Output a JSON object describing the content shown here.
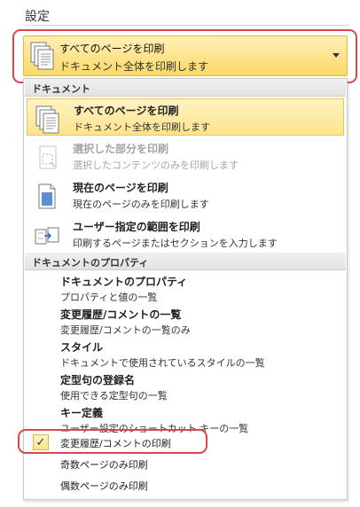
{
  "settings": {
    "title": "設定"
  },
  "dropdown": {
    "title": "すべてのページを印刷",
    "subtitle": "ドキュメント全体を印刷します"
  },
  "menu": {
    "groups": [
      {
        "header": "ドキュメント"
      },
      {
        "header": "ドキュメントのプロパティ"
      }
    ],
    "print_items": [
      {
        "title": "すべてのページを印刷",
        "desc": "ドキュメント全体を印刷します",
        "state": "selected",
        "icon": "all-pages-icon"
      },
      {
        "title": "選択した部分を印刷",
        "desc": "選択したコンテンツのみを印刷します",
        "state": "disabled",
        "icon": "selection-icon"
      },
      {
        "title": "現在のページを印刷",
        "desc": "現在のページのみを印刷します",
        "state": "normal",
        "icon": "current-page-icon"
      },
      {
        "title": "ユーザー指定の範囲を印刷",
        "desc": "印刷するページまたはセクションを入力します",
        "state": "normal",
        "icon": "custom-range-icon"
      }
    ],
    "property_items": [
      {
        "title": "ドキュメントのプロパティ",
        "desc": "プロパティと値の一覧"
      },
      {
        "title": "変更履歴/コメントの一覧",
        "desc": "変更履歴/コメントの一覧のみ"
      },
      {
        "title": "スタイル",
        "desc": "ドキュメントで使用されているスタイルの一覧"
      },
      {
        "title": "定型句の登録名",
        "desc": "使用できる定型句の一覧"
      },
      {
        "title": "キー定義",
        "desc": "ユーザー設定のショートカット キーの一覧"
      }
    ],
    "toggles": [
      {
        "label": "変更履歴/コメントの印刷",
        "checked": true,
        "check_glyph": "✓"
      },
      {
        "label": "奇数ページのみ印刷",
        "checked": false
      },
      {
        "label": "偶数ページのみ印刷",
        "checked": false
      }
    ]
  },
  "colors": {
    "accent": "#fde38c",
    "highlight_border": "#d9474b"
  }
}
